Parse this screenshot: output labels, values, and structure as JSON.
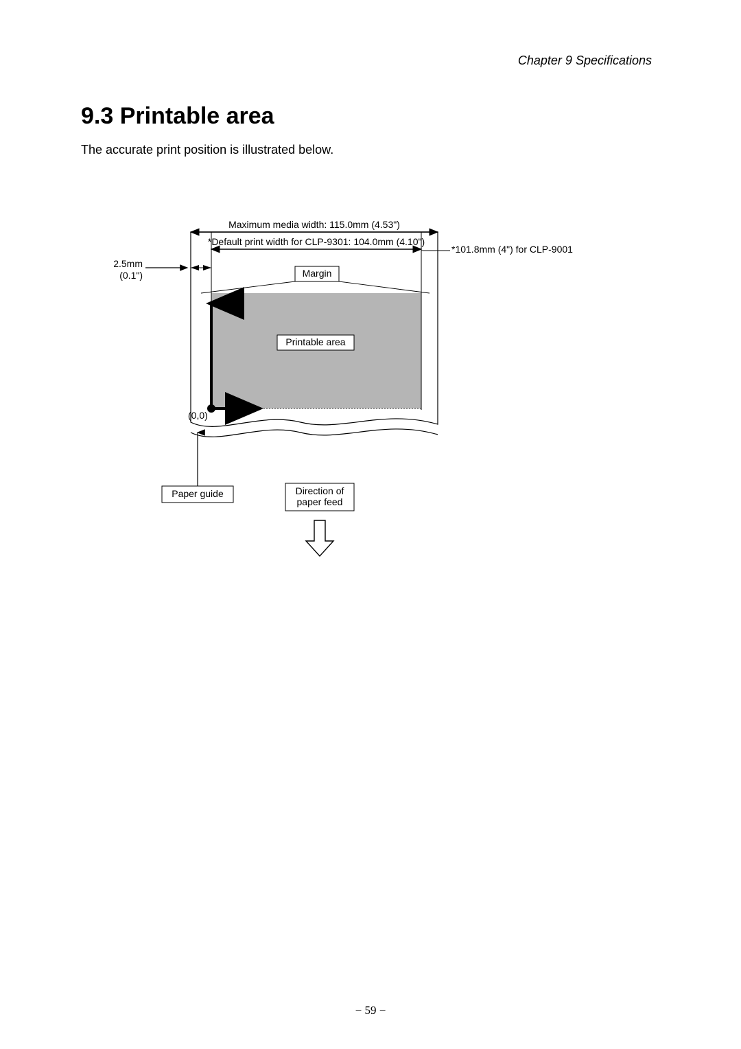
{
  "header": "Chapter 9    Specifications",
  "section_title": "9.3   Printable area",
  "intro": "The accurate print position is illustrated below.",
  "diagram": {
    "max_media_width": "Maximum media width: 115.0mm (4.53\")",
    "default_print_width": "*Default print width for CLP-9301: 104.0mm (4.10\")",
    "note_9001": "*101.8mm (4\") for CLP-9001",
    "left_margin_line1": "2.5mm",
    "left_margin_line2": "(0.1\")",
    "margin_box": "Margin",
    "printable_area_box": "Printable area",
    "origin": "(0,0)",
    "paper_guide": "Paper guide",
    "direction_line1": "Direction of",
    "direction_line2": "paper feed"
  },
  "page_number": "− 59 −"
}
